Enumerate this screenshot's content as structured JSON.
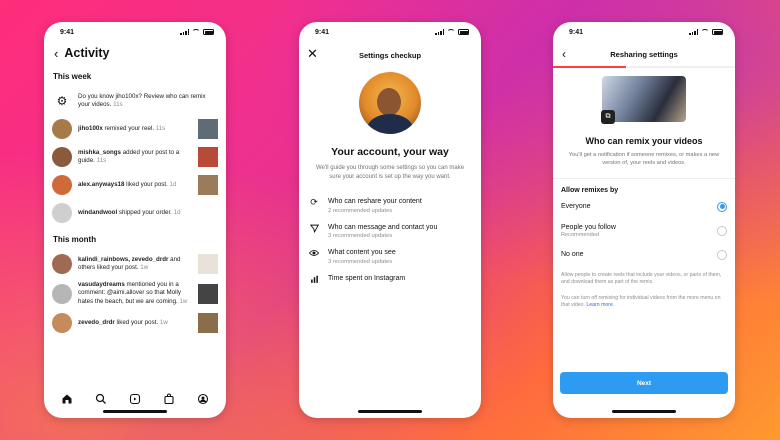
{
  "status": {
    "time": "9:41"
  },
  "activity": {
    "title": "Activity",
    "week_label": "This week",
    "month_label": "This month",
    "week": [
      {
        "user": "",
        "text": "Do you know jiho100x? Review who can remix your videos.",
        "time": "11s",
        "kind": "gear"
      },
      {
        "user": "jiho100x",
        "text": " remixed your reel.",
        "time": "11s",
        "av": "#a77a4a",
        "th": "#5f6b77"
      },
      {
        "user": "mishka_songs",
        "text": " added your post to a guide.",
        "time": "11s",
        "av": "#8a5a3c",
        "th": "#b84a3a"
      },
      {
        "user": "alex.anyways18",
        "text": " liked your post.",
        "time": "1d",
        "av": "#cf6b3b",
        "th": "#9a7b5b"
      },
      {
        "user": "windandwool",
        "text": " shipped your order.",
        "time": "1d",
        "av": "#cfcfcf",
        "th": ""
      }
    ],
    "month": [
      {
        "user": "kalindi_rainbows, zevedo_drdr",
        "text": " and others liked your post.",
        "time": "1w",
        "av": "#a06a52",
        "th": "#e8e2d8"
      },
      {
        "user": "vasudaydreams",
        "text": " mentioned you in a comment: @aimi.allover so that Molly hates the beach, but we are coming.",
        "time": "1w",
        "av": "#b6b6b6",
        "th": "#444"
      },
      {
        "user": "zevedo_drdr",
        "text": " liked your post.",
        "time": "1w",
        "av": "#c58b5a",
        "th": "#8a6e4a"
      }
    ],
    "tabs": [
      "home-icon",
      "search-icon",
      "reels-icon",
      "shop-icon",
      "profile-icon"
    ]
  },
  "checkup": {
    "title": "Settings checkup",
    "heading": "Your account, your way",
    "subtitle": "We'll guide you through some settings so you can make sure your account is set up the way you want.",
    "items": [
      {
        "icon": "reshare-icon",
        "title": "Who can reshare your content",
        "sub": "2 recommended updates"
      },
      {
        "icon": "message-icon",
        "title": "Who can message and contact you",
        "sub": "3 recommended updates"
      },
      {
        "icon": "eye-icon",
        "title": "What content you see",
        "sub": "3 recommended updates"
      },
      {
        "icon": "chart-icon",
        "title": "Time spent on Instagram",
        "sub": ""
      }
    ]
  },
  "resharing": {
    "title": "Resharing settings",
    "heading": "Who can remix your videos",
    "subtitle": "You'll get a notification if someone remixes, or makes a new version of, your reels and videos.",
    "allow_label": "Allow remixes by",
    "options": [
      {
        "label": "Everyone",
        "sub": "",
        "selected": true
      },
      {
        "label": "People you follow",
        "sub": "Recommended",
        "selected": false
      },
      {
        "label": "No one",
        "sub": "",
        "selected": false
      }
    ],
    "fine1": "Allow people to create reels that include your videos, or parts of them, and download them as part of the remix.",
    "fine2": "You can turn off remixing for individual videos from the more menu on that video.",
    "learn_more": "Learn more.",
    "next_label": "Next"
  },
  "colors": {
    "accent": "#2e9bf2",
    "link": "#2f6fd6"
  }
}
